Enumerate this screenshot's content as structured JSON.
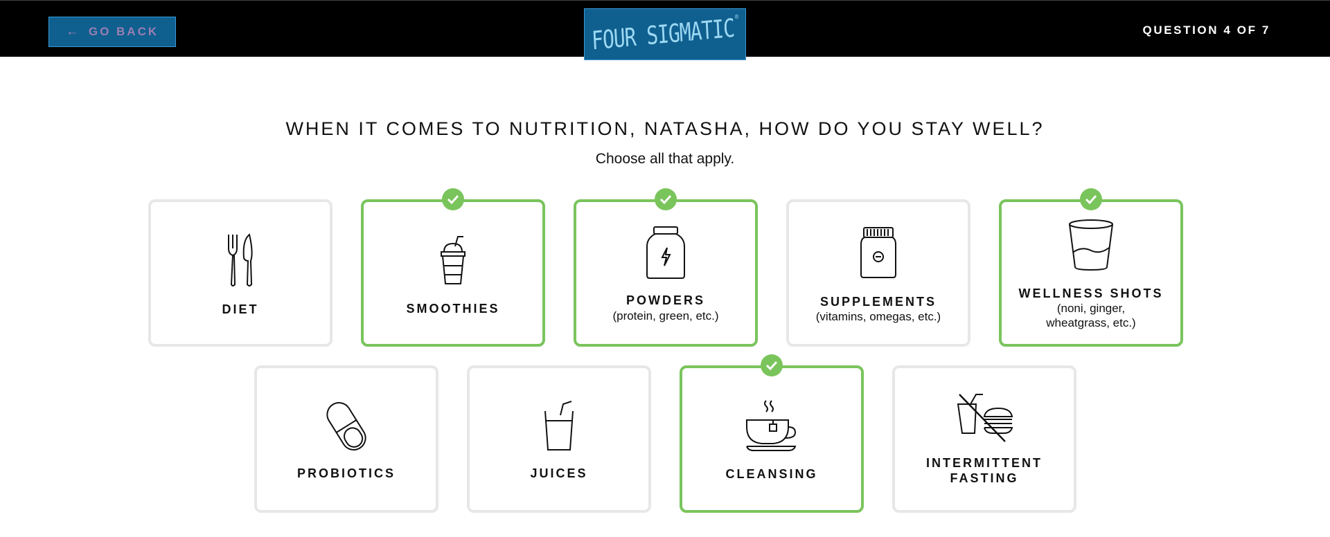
{
  "header": {
    "back_label": "GO BACK",
    "logo_text": "FOUR SIGMATIC",
    "progress": "QUESTION 4 OF 7"
  },
  "question": {
    "title": "WHEN IT COMES TO NUTRITION, NATASHA, HOW DO YOU STAY WELL?",
    "subtitle": "Choose all that apply."
  },
  "options": [
    {
      "label": "DIET",
      "sub": "",
      "icon": "fork-knife-icon",
      "selected": false
    },
    {
      "label": "SMOOTHIES",
      "sub": "",
      "icon": "smoothie-cup-icon",
      "selected": true
    },
    {
      "label": "POWDERS",
      "sub": "(protein, green, etc.)",
      "icon": "powder-jar-icon",
      "selected": true
    },
    {
      "label": "SUPPLEMENTS",
      "sub": "(vitamins, omegas, etc.)",
      "icon": "supplement-bottle-icon",
      "selected": false
    },
    {
      "label": "WELLNESS SHOTS",
      "sub": "(noni, ginger, wheatgrass, etc.)",
      "icon": "shot-glass-icon",
      "selected": true
    },
    {
      "label": "PROBIOTICS",
      "sub": "",
      "icon": "capsule-icon",
      "selected": false
    },
    {
      "label": "JUICES",
      "sub": "",
      "icon": "juice-glass-icon",
      "selected": false
    },
    {
      "label": "CLEANSING",
      "sub": "",
      "icon": "tea-cup-icon",
      "selected": true
    },
    {
      "label": "INTERMITTENT FASTING",
      "sub": "",
      "icon": "no-food-icon",
      "selected": false
    }
  ],
  "colors": {
    "header_bg": "#000000",
    "button_bg": "#0f5f8f",
    "selected_border": "#7ac45c",
    "unselected_border": "#e7e7e7"
  }
}
